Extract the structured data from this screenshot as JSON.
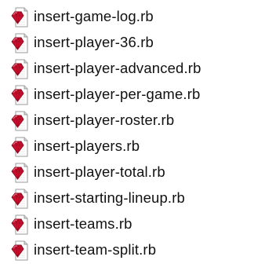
{
  "files": [
    {
      "name": "insert-game-log.rb",
      "icon": "ruby-file-icon"
    },
    {
      "name": "insert-player-36.rb",
      "icon": "ruby-file-icon"
    },
    {
      "name": "insert-player-advanced.rb",
      "icon": "ruby-file-icon"
    },
    {
      "name": "insert-player-per-game.rb",
      "icon": "ruby-file-icon"
    },
    {
      "name": "insert-player-roster.rb",
      "icon": "ruby-file-icon"
    },
    {
      "name": "insert-players.rb",
      "icon": "ruby-file-icon"
    },
    {
      "name": "insert-player-total.rb",
      "icon": "ruby-file-icon"
    },
    {
      "name": "insert-starting-lineup.rb",
      "icon": "ruby-file-icon"
    },
    {
      "name": "insert-teams.rb",
      "icon": "ruby-file-icon"
    },
    {
      "name": "insert-team-split.rb",
      "icon": "ruby-file-icon"
    }
  ],
  "colors": {
    "ruby_gem": "#c8102e",
    "ruby_gem_dark": "#8a0a1e",
    "page_fold": "#d8d8d8",
    "text": "#111111"
  }
}
